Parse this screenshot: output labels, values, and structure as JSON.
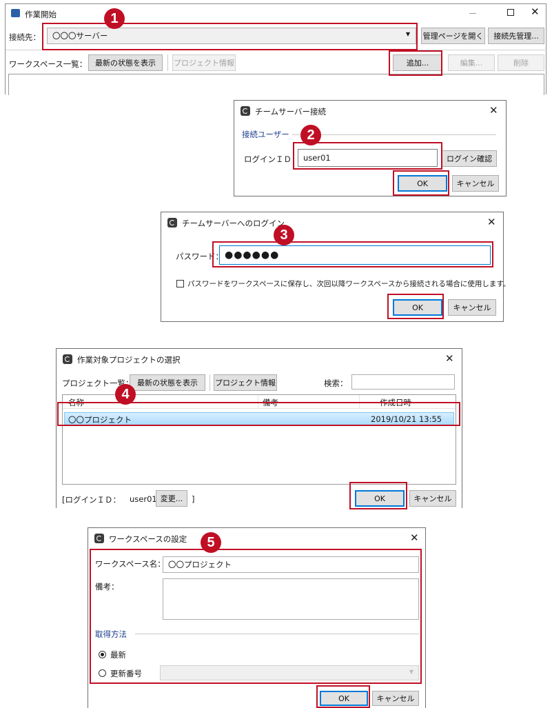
{
  "colors": {
    "accent": "#c00f25",
    "focus": "#0078d7",
    "selection": "#cce8ff"
  },
  "main_window": {
    "title": "作業開始",
    "connect_label": "接続先：",
    "server_value": "〇〇〇サーバー",
    "open_admin_button": "管理ページを開く",
    "connect_manage_button": "接続先管理...",
    "workspace_list_label": "ワークスペース一覧：",
    "refresh_button": "最新の状態を表示",
    "project_info_button": "プロジェクト情報",
    "add_button": "追加...",
    "edit_button": "編集...",
    "delete_button": "削除"
  },
  "team_server_dialog": {
    "title": "チームサーバー接続",
    "group_label": "接続ユーザー",
    "login_id_label": "ログインＩＤ：",
    "login_id_value": "user01",
    "login_check_button": "ログイン確認",
    "ok_button": "OK",
    "cancel_button": "キャンセル"
  },
  "login_dialog": {
    "title": "チームサーバーへのログイン",
    "password_label": "パスワード：",
    "password_value": "●●●●●●",
    "save_password_label": "パスワードをワークスペースに保存し、次回以降ワークスペースから接続される場合に使用します。",
    "ok_button": "OK",
    "cancel_button": "キャンセル"
  },
  "project_select_dialog": {
    "title": "作業対象プロジェクトの選択",
    "list_label": "プロジェクト一覧：",
    "refresh_button": "最新の状態を表示",
    "project_info_button": "プロジェクト情報",
    "search_label": "検索：",
    "columns": [
      "名称",
      "備考",
      "作成日時"
    ],
    "rows": [
      {
        "name": "〇〇プロジェクト",
        "note": "",
        "created": "2019/10/21 13:55"
      }
    ],
    "login_prefix": "[ログインＩＤ：",
    "login_user": "user01",
    "change_button": "変更...",
    "login_suffix": "]",
    "ok_button": "OK",
    "cancel_button": "キャンセル"
  },
  "workspace_dialog": {
    "title": "ワークスペースの設定",
    "name_label": "ワークスペース名：",
    "name_value": "〇〇プロジェクト",
    "note_label": "備考：",
    "acquire_label": "取得方法",
    "radio_latest": "最新",
    "radio_revision": "更新番号",
    "ok_button": "OK",
    "cancel_button": "キャンセル"
  },
  "callouts": [
    "1",
    "2",
    "3",
    "4",
    "5"
  ]
}
